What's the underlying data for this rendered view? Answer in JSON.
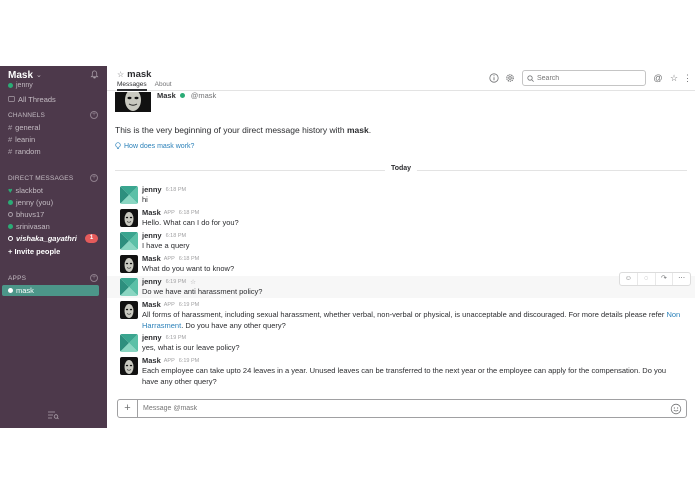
{
  "sidebar": {
    "team_name": "Mask",
    "team_caret": "⌄",
    "user": "jenny",
    "all_threads": "All Threads",
    "channels_heading": "CHANNELS",
    "channels": [
      {
        "label": "general"
      },
      {
        "label": "leanin"
      },
      {
        "label": "random"
      }
    ],
    "dm_heading": "DIRECT MESSAGES",
    "dms": [
      {
        "label": "slackbot"
      },
      {
        "label": "jenny (you)"
      },
      {
        "label": "bhuvs17"
      },
      {
        "label": "srinivasan"
      },
      {
        "label": "vishaka_gayathri",
        "badge": "1"
      }
    ],
    "invite": "+ Invite people",
    "apps_heading": "APPS",
    "apps": [
      {
        "label": "mask"
      }
    ]
  },
  "header": {
    "channel_name": "mask",
    "tabs": [
      "Messages",
      "About"
    ],
    "search_placeholder": "Search"
  },
  "intro": {
    "bot_name": "Mask",
    "bot_handle": "@mask",
    "text_prefix": "This is the very beginning of your direct message history with ",
    "text_name": "mask",
    "text_suffix": ".",
    "help_link": "How does mask work?"
  },
  "day_divider": "Today",
  "messages": [
    {
      "author": "jenny",
      "app": "",
      "time": "6:18 PM",
      "text": "hi"
    },
    {
      "author": "Mask",
      "app": "APP",
      "time": "6:18 PM",
      "text": "Hello. What can I do for you?"
    },
    {
      "author": "jenny",
      "app": "",
      "time": "6:18 PM",
      "text": "I have a query"
    },
    {
      "author": "Mask",
      "app": "APP",
      "time": "6:18 PM",
      "text": "What do you want to know?"
    },
    {
      "author": "jenny",
      "app": "",
      "time": "6:19 PM",
      "text": "Do we have anti harassment policy?"
    },
    {
      "author": "Mask",
      "app": "APP",
      "time": "6:19 PM",
      "text": "All forms of harassment, including sexual harassment, whether verbal, non-verbal or physical, is unacceptable and discouraged. For more details please refer ",
      "link": "Non Harrasment",
      "text_after": ". Do you have any other query?"
    },
    {
      "author": "jenny",
      "app": "",
      "time": "6:19 PM",
      "text": "yes, what is our leave policy?"
    },
    {
      "author": "Mask",
      "app": "APP",
      "time": "6:19 PM",
      "text": "Each employee can take upto 24 leaves in a year. Unused leaves can be transferred to the next year or the employee can apply for the compensation. Do you have any other query?"
    }
  ],
  "composer": {
    "placeholder": "Message @mask"
  },
  "colors": {
    "sidebar_bg": "#4d394b",
    "active_item": "#4c9689",
    "presence": "#2bac76",
    "badge": "#e45b5b",
    "link": "#2a80b9"
  }
}
